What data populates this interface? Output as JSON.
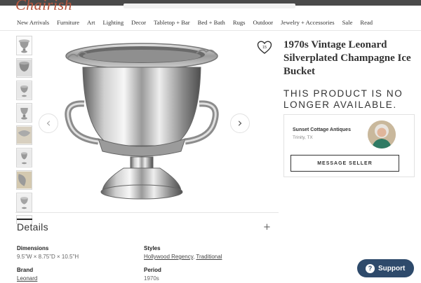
{
  "header": {
    "logo_text": "Chairish"
  },
  "nav": {
    "items": [
      "New Arrivals",
      "Furniture",
      "Art",
      "Lighting",
      "Decor",
      "Tabletop + Bar",
      "Bed + Bath",
      "Rugs",
      "Outdoor",
      "Jewelry + Accessories",
      "Sale",
      "Read"
    ]
  },
  "product": {
    "title": "1970s Vintage Leonard Silverplated Champagne Ice Bucket",
    "unavailable": "THIS PRODUCT IS NO LONGER AVAILABLE.",
    "favorite_count": "15",
    "thumbnail_count": 8
  },
  "seller": {
    "name": "Sunset Cottage Antiques",
    "location": "Trinity, TX",
    "message_button": "MESSAGE SELLER"
  },
  "details": {
    "heading": "Details",
    "dimensions_label": "Dimensions",
    "dimensions_value": "9.5\"W × 8.75\"D × 10.5\"H",
    "styles_label": "Styles",
    "styles_values": [
      "Hollywood Regency",
      "Traditional"
    ],
    "brand_label": "Brand",
    "brand_value": "Leonard",
    "period_label": "Period",
    "period_value": "1970s"
  },
  "support": {
    "label": "Support"
  },
  "colors": {
    "brand": "#b9573f",
    "support_bg": "#2e4a6b"
  }
}
